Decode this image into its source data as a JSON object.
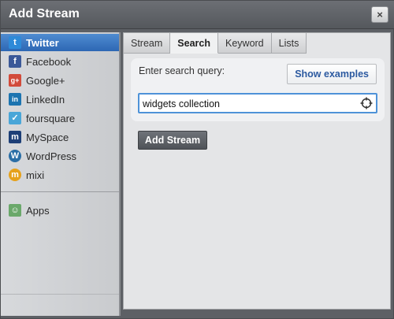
{
  "dialog": {
    "title": "Add Stream",
    "close_label": "×"
  },
  "sidebar": {
    "networks": [
      {
        "label": "Twitter",
        "icon": "twitter-icon",
        "color": "#2e8ad8",
        "glyph": "t",
        "active": true
      },
      {
        "label": "Facebook",
        "icon": "facebook-icon",
        "color": "#3b5998",
        "glyph": "f"
      },
      {
        "label": "Google+",
        "icon": "google-plus-icon",
        "color": "#d24b3a",
        "glyph": "g+"
      },
      {
        "label": "LinkedIn",
        "icon": "linkedin-icon",
        "color": "#1c74b0",
        "glyph": "in"
      },
      {
        "label": "foursquare",
        "icon": "foursquare-icon",
        "color": "#49a6d8",
        "glyph": "✓"
      },
      {
        "label": "MySpace",
        "icon": "myspace-icon",
        "color": "#1d3f77",
        "glyph": "m"
      },
      {
        "label": "WordPress",
        "icon": "wordpress-icon",
        "color": "#2a6ea6",
        "glyph": "W"
      },
      {
        "label": "mixi",
        "icon": "mixi-icon",
        "color": "#e6a11b",
        "glyph": "m"
      }
    ],
    "apps": {
      "label": "Apps",
      "icon": "apps-icon",
      "color": "#6aa86a"
    }
  },
  "tabs": [
    {
      "label": "Stream"
    },
    {
      "label": "Search",
      "active": true
    },
    {
      "label": "Keyword"
    },
    {
      "label": "Lists"
    }
  ],
  "search": {
    "label": "Enter search query:",
    "examples_button": "Show examples",
    "query_value": "widgets collection"
  },
  "actions": {
    "add_stream": "Add Stream"
  }
}
